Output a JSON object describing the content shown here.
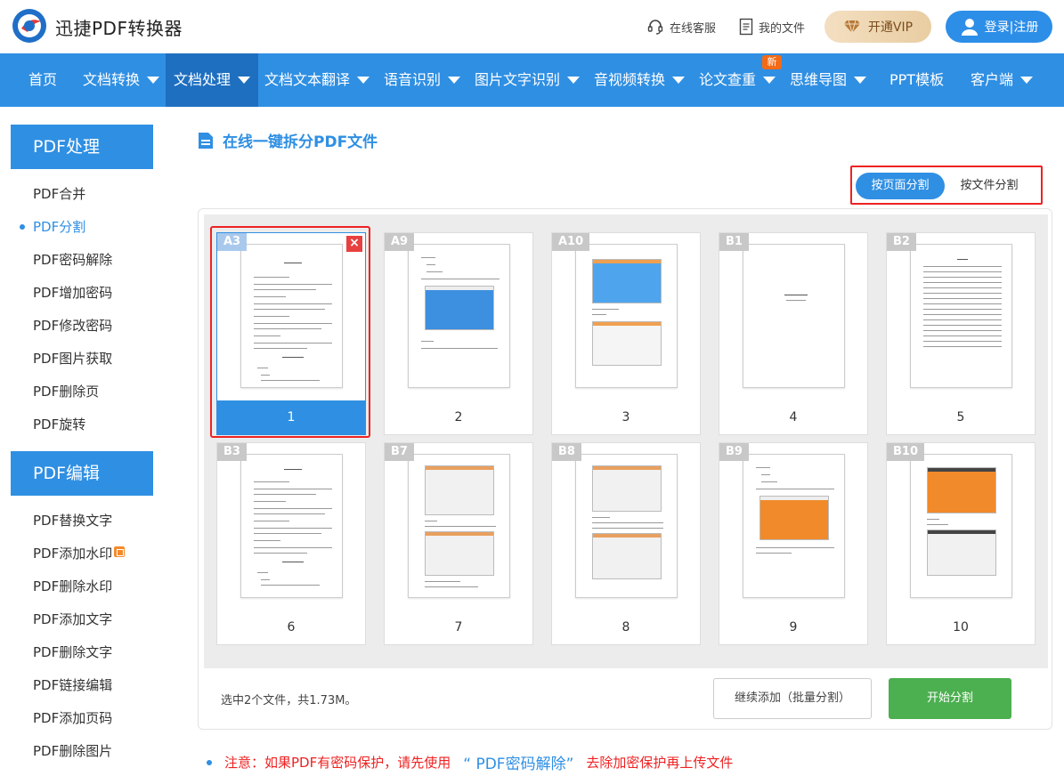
{
  "header": {
    "app_name": "迅捷PDF转换器",
    "links": [
      {
        "label": "在线客服",
        "icon": "headset-icon"
      },
      {
        "label": "我的文件",
        "icon": "document-icon"
      }
    ],
    "vip_label": "开通VIP",
    "login_label": "登录|注册"
  },
  "nav": {
    "items": [
      {
        "label": "首页"
      },
      {
        "label": "文档转换"
      },
      {
        "label": "文档处理"
      },
      {
        "label": "文档文本翻译"
      },
      {
        "label": "语音识别"
      },
      {
        "label": "图片文字识别"
      },
      {
        "label": "音视频转换"
      },
      {
        "label": "论文查重"
      },
      {
        "label": "思维导图"
      },
      {
        "label": "PPT模板"
      },
      {
        "label": "客户端"
      }
    ],
    "new_badge": "新"
  },
  "sidebar": {
    "section1_title": "PDF处理",
    "section1_items": [
      "PDF合并",
      "PDF分割",
      "PDF密码解除",
      "PDF增加密码",
      "PDF修改密码",
      "PDF图片获取",
      "PDF删除页",
      "PDF旋转"
    ],
    "section2_title": "PDF编辑",
    "section2_items": [
      "PDF替换文字",
      "PDF添加水印",
      "PDF删除水印",
      "PDF添加文字",
      "PDF删除文字",
      "PDF链接编辑",
      "PDF添加页码",
      "PDF删除图片"
    ]
  },
  "main": {
    "title": "在线一键拆分PDF文件",
    "mode_by_page": "按页面分割",
    "mode_by_file": "按文件分割",
    "pages": [
      {
        "tag": "A3",
        "num": "1"
      },
      {
        "tag": "A9",
        "num": "2"
      },
      {
        "tag": "A10",
        "num": "3"
      },
      {
        "tag": "B1",
        "num": "4"
      },
      {
        "tag": "B2",
        "num": "5"
      },
      {
        "tag": "B3",
        "num": "6"
      },
      {
        "tag": "B7",
        "num": "7"
      },
      {
        "tag": "B8",
        "num": "8"
      },
      {
        "tag": "B9",
        "num": "9"
      },
      {
        "tag": "B10",
        "num": "10"
      }
    ],
    "close_glyph": "×",
    "status": "选中2个文件，共1.73M。",
    "add_more_label": "继续添加（批量分割）",
    "start_label": "开始分割"
  },
  "notice": {
    "prefix": "注意：如果PDF有密码保护，请先使用",
    "link": "“ PDF密码解除”",
    "suffix": "去除加密保护再上传文件"
  },
  "colors": {
    "primary": "#2f8fe3",
    "nav_active": "#1e6fc0",
    "danger": "#e22222",
    "success": "#4caf50"
  }
}
